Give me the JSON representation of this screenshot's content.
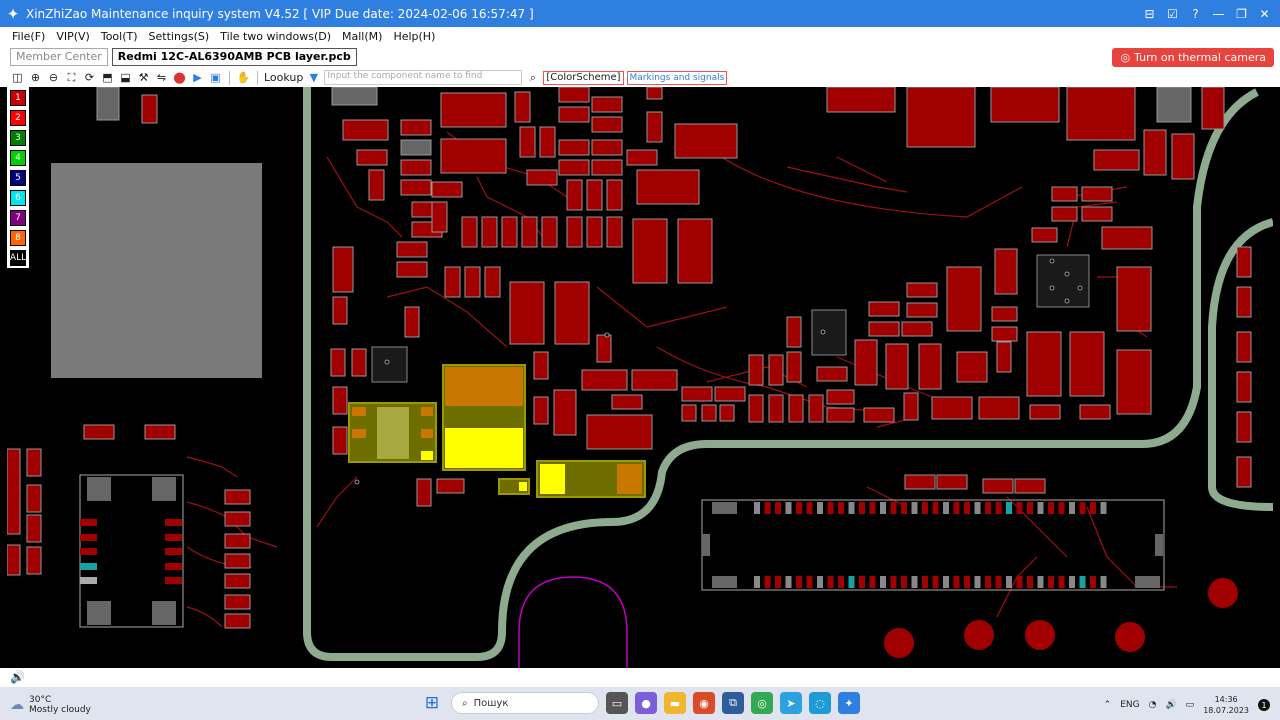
{
  "window": {
    "title": "XinZhiZao Maintenance inquiry system V4.52 [ VIP Due date: 2024-02-06 16:57:47 ]",
    "buttons": [
      "⊟",
      "☑",
      "?",
      "—",
      "❐",
      "✕"
    ]
  },
  "menu": [
    "File(F)",
    "VIP(V)",
    "Tool(T)",
    "Settings(S)",
    "Tile two windows(D)",
    "Mall(M)",
    "Help(H)"
  ],
  "tabs": [
    {
      "label": "Member Center",
      "active": false
    },
    {
      "label": "Redmi 12C-AL6390AMB PCB layer.pcb",
      "active": true
    }
  ],
  "thermal_button": "Turn on thermal camera",
  "toolbar": {
    "lookup_label": "Lookup",
    "search_placeholder": "Input the component name to find",
    "color_scheme": "[ColorScheme]",
    "markings": "Markings and signals"
  },
  "layers": [
    {
      "label": "1",
      "color": "#c80000"
    },
    {
      "label": "2",
      "color": "#ff0000"
    },
    {
      "label": "3",
      "color": "#008000"
    },
    {
      "label": "4",
      "color": "#00d000"
    },
    {
      "label": "5",
      "color": "#000080"
    },
    {
      "label": "6",
      "color": "#00e5ee"
    },
    {
      "label": "7",
      "color": "#800080"
    },
    {
      "label": "8",
      "color": "#ff6600"
    },
    {
      "label": "ALL",
      "color": "#000000"
    }
  ],
  "taskbar": {
    "temperature": "30°C",
    "weather": "Mostly cloudy",
    "search_placeholder": "Пошук",
    "language": "ENG",
    "time": "14:36",
    "date": "18.07.2023"
  },
  "colors": {
    "accent": "#2f7fe0",
    "pad": "#a00000",
    "trace": "#a01010",
    "board_outline": "#8fab8f",
    "highlight_yellow": "#ffff00",
    "highlight_orange": "#c87800"
  }
}
